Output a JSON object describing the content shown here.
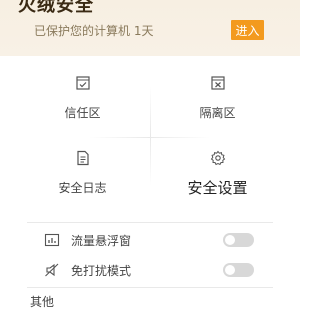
{
  "header": {
    "title": "火绒安全",
    "status_text": "已保护您的计算机 1天",
    "enter_label": "进入",
    "accent_color": "#f39a1e"
  },
  "grid": {
    "items": [
      {
        "label": "信任区",
        "icon": "check-box-icon"
      },
      {
        "label": "隔离区",
        "icon": "x-box-icon"
      },
      {
        "label": "安全日志",
        "icon": "document-icon"
      },
      {
        "label": "安全设置",
        "icon": "gear-icon"
      }
    ]
  },
  "settings": {
    "items": [
      {
        "label": "流量悬浮窗",
        "icon": "traffic-chart-icon",
        "enabled": false
      },
      {
        "label": "免打扰模式",
        "icon": "mute-icon",
        "enabled": false
      }
    ]
  },
  "footer": {
    "partial_label": "其他"
  }
}
